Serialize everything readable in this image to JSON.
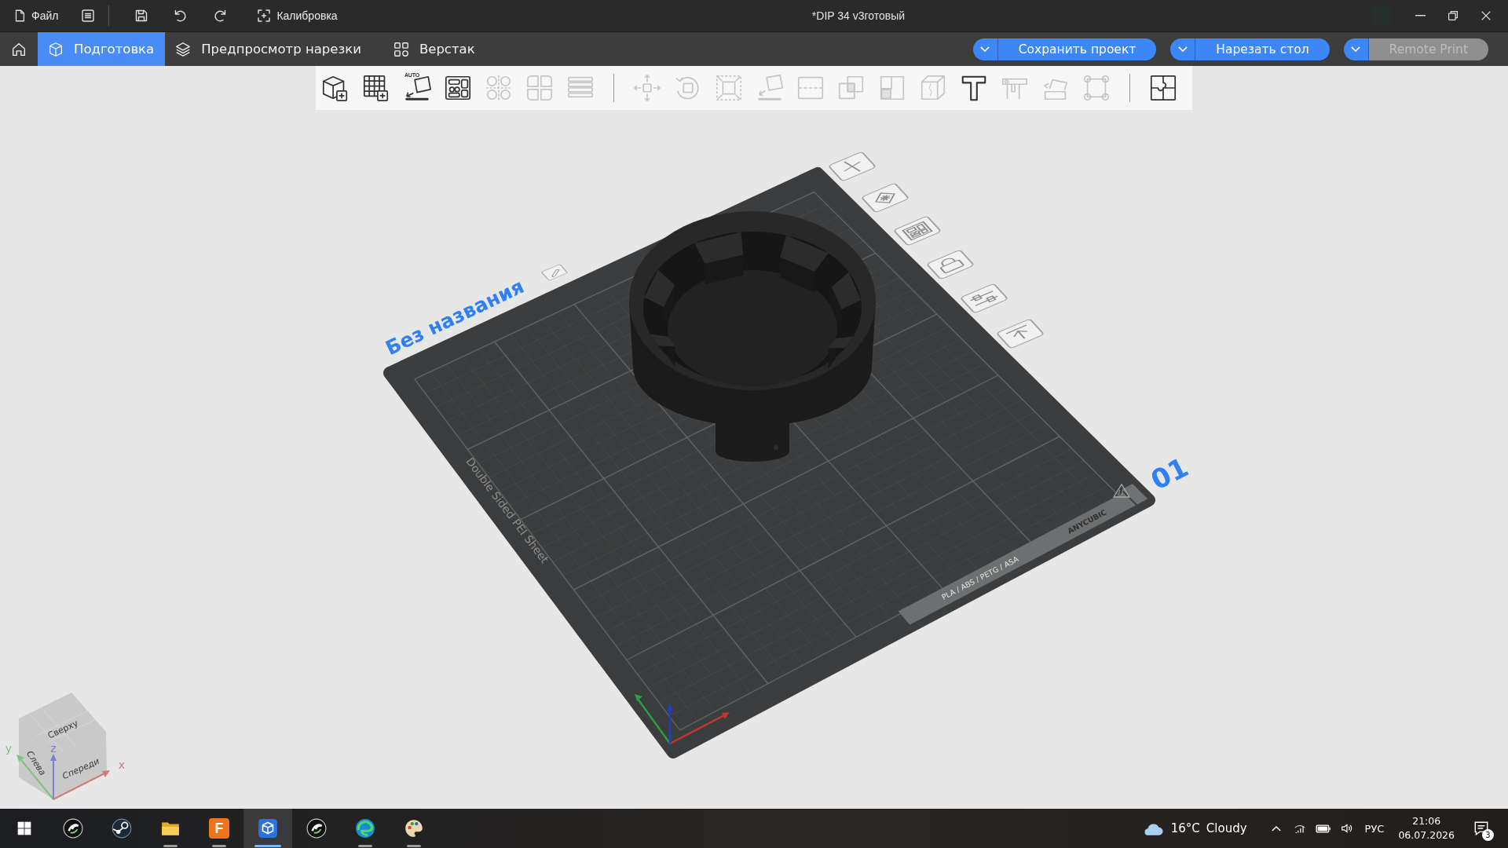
{
  "title_bar": {
    "file_menu": "Файл",
    "calibration": "Калибровка",
    "title": "*DIP 34 v3готовый"
  },
  "tabs": [
    {
      "label": "Подготовка",
      "selected": true
    },
    {
      "label": "Предпросмотр нарезки",
      "selected": false
    },
    {
      "label": "Верстак",
      "selected": false
    }
  ],
  "actions": [
    {
      "label": "Сохранить проект",
      "disabled": false
    },
    {
      "label": "Нарезать стол",
      "disabled": false
    },
    {
      "label": "Remote Print",
      "disabled": true
    }
  ],
  "toolbar": {
    "groups": [
      {
        "tools": [
          {
            "kind": "cube",
            "disabled": false
          },
          {
            "kind": "plate",
            "disabled": false
          },
          {
            "kind": "orient",
            "disabled": false,
            "badge": "AUTO"
          },
          {
            "kind": "arrange",
            "disabled": false
          },
          {
            "kind": "split",
            "disabled": true
          },
          {
            "kind": "parts",
            "disabled": true
          },
          {
            "kind": "layers",
            "disabled": true
          }
        ]
      },
      {
        "tools": [
          {
            "kind": "move",
            "disabled": true
          },
          {
            "kind": "rotate",
            "disabled": true
          },
          {
            "kind": "scale",
            "disabled": true
          },
          {
            "kind": "face",
            "disabled": true
          },
          {
            "kind": "cut",
            "disabled": true
          },
          {
            "kind": "boolean",
            "disabled": true
          },
          {
            "kind": "paint",
            "disabled": true
          },
          {
            "kind": "mesh",
            "disabled": true
          },
          {
            "kind": "text",
            "disabled": false
          },
          {
            "kind": "measure",
            "disabled": true
          },
          {
            "kind": "assembly",
            "disabled": true
          },
          {
            "kind": "repair",
            "disabled": true
          }
        ]
      },
      {
        "tools": [
          {
            "kind": "puzzle",
            "disabled": false
          }
        ]
      }
    ]
  },
  "plate": {
    "name": "Без названия",
    "number": "01",
    "sheet_label": "Double Sided PEI Sheet",
    "filament_label": "PLA / ABS / PETG / ASA",
    "brand_label": "ANYCUBIC"
  },
  "view_cube": {
    "top": "Сверху",
    "left": "Слева",
    "front": "Спереди",
    "axis_x": "x",
    "axis_y": "y",
    "axis_z": "z"
  },
  "taskbar": {
    "apps": [
      {
        "kind": "swirl",
        "running": false,
        "active": false
      },
      {
        "kind": "valve",
        "running": false,
        "active": false
      },
      {
        "kind": "folder",
        "running": true,
        "active": false
      },
      {
        "kind": "tile",
        "label": "F",
        "running": true,
        "active": false
      },
      {
        "kind": "cube",
        "running": true,
        "active": true
      },
      {
        "kind": "swirl",
        "running": false,
        "active": false
      },
      {
        "kind": "browser",
        "running": true,
        "active": false
      },
      {
        "kind": "palette",
        "running": true,
        "active": false
      }
    ],
    "weather": {
      "temperature": "16°C",
      "condition": "Cloudy"
    },
    "language": "РУС",
    "time": "21:06",
    "date": "06.07.2026",
    "notifications": "3"
  }
}
